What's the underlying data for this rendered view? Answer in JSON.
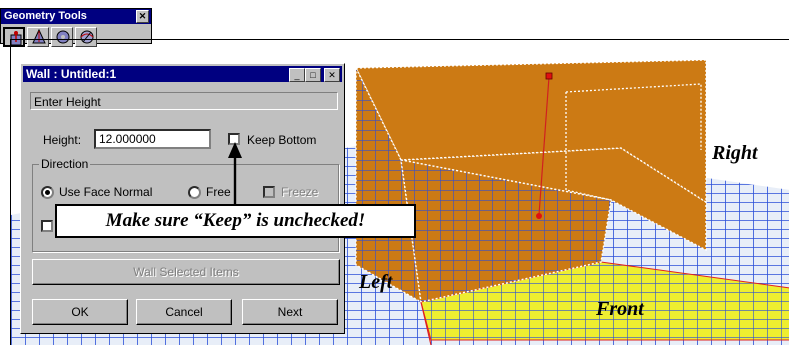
{
  "geometry_tools": {
    "title": "Geometry Tools",
    "close_glyph": "✕",
    "tools": [
      {
        "icon": "wall-tool-icon",
        "active": true
      },
      {
        "icon": "cone-tool-icon",
        "active": false
      },
      {
        "icon": "disc-tool-icon",
        "active": false
      },
      {
        "icon": "sphere-tool-icon",
        "active": false
      }
    ]
  },
  "dialog": {
    "title": "Wall : Untitled:1",
    "minimize_glyph": "_",
    "maximize_glyph": "□",
    "close_glyph": "✕",
    "status_text": "Enter Height",
    "height_label": "Height:",
    "height_value": "12.000000",
    "keep_bottom_label": "Keep Bottom",
    "keep_bottom_checked": false,
    "direction_label": "Direction",
    "use_face_normal_label": "Use Face Normal",
    "free_label": "Free",
    "freeze_label": "Freeze",
    "wall_selected_label": "Wall Selected Items",
    "ok_label": "OK",
    "cancel_label": "Cancel",
    "next_label": "Next"
  },
  "annotations": {
    "callout": "Make sure “Keep” is unchecked!",
    "left": "Left",
    "right": "Right",
    "front": "Front"
  },
  "colors": {
    "grid_blue": "#2a4fd8",
    "wall_orange": "#cc7a14",
    "floor_yellow": "#eeee30",
    "title_navy": "#000080"
  }
}
